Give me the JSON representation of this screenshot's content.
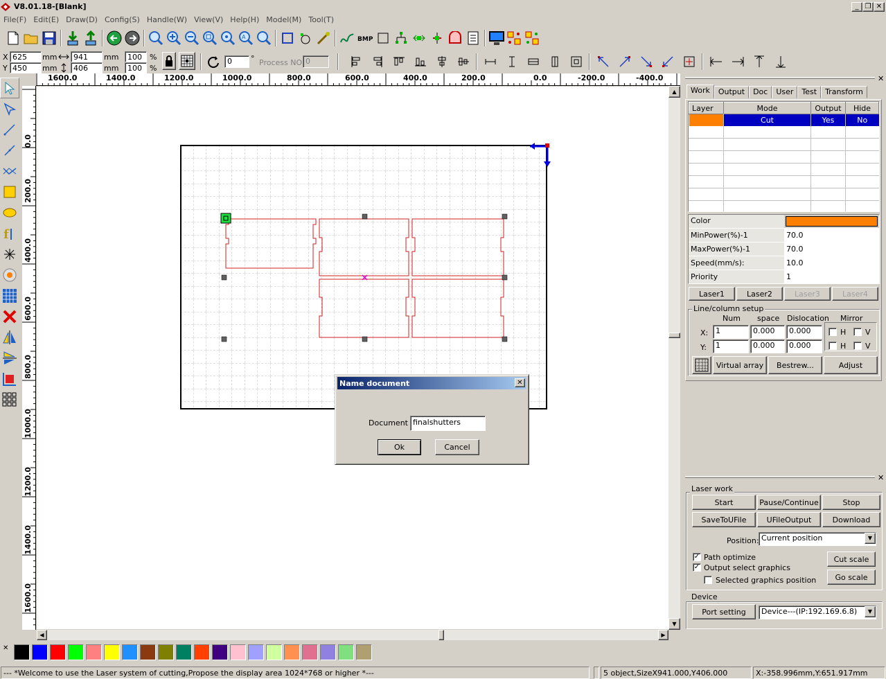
{
  "window": {
    "title": "V8.01.18-[Blank]"
  },
  "menu": [
    "File(F)",
    "Edit(E)",
    "Draw(D)",
    "Config(S)",
    "Handle(W)",
    "View(V)",
    "Help(H)",
    "Model(M)",
    "Tool(T)"
  ],
  "coords": {
    "x_label": "X",
    "x_value": "625",
    "x_unit": "mm",
    "y_label": "Y",
    "y_value": "450",
    "y_unit": "mm",
    "w_value": "941",
    "w_unit": "mm",
    "h_value": "406",
    "h_unit": "mm",
    "sx_value": "100",
    "sx_unit": "%",
    "sy_value": "100",
    "sy_unit": "%",
    "rotate_value": "0",
    "rotate_unit": "°",
    "process_label": "Process NO:",
    "process_value": "0"
  },
  "ruler_h": [
    "1600.0",
    "1400.0",
    "1200.0",
    "1000.0",
    "800.0",
    "600.0",
    "400.0",
    "200.0",
    "0.0",
    "-200.0",
    "-400.0"
  ],
  "ruler_v": [
    "0.0",
    "200.0",
    "400.0",
    "600.0",
    "800.0",
    "1000.0",
    "1200.0",
    "1400.0",
    "1600.0"
  ],
  "panel": {
    "tabs": [
      "Work",
      "Output",
      "Doc",
      "User",
      "Test",
      "Transform"
    ],
    "layer_headers": [
      "Layer",
      "Mode",
      "Output",
      "Hide"
    ],
    "layer_row": {
      "mode": "Cut",
      "output": "Yes",
      "hide": "No",
      "color": "#ff8000"
    },
    "props": [
      {
        "label": "Color",
        "value": ""
      },
      {
        "label": "MinPower(%)-1",
        "value": "70.0"
      },
      {
        "label": "MaxPower(%)-1",
        "value": "70.0"
      },
      {
        "label": "Speed(mm/s):",
        "value": "10.0"
      },
      {
        "label": "Priority",
        "value": "1"
      }
    ],
    "lasers": [
      "Laser1",
      "Laser2",
      "Laser3",
      "Laser4"
    ],
    "linecol": {
      "title": "Line/column setup",
      "h_num": "Num",
      "h_space": "space",
      "h_disl": "Dislocation",
      "h_mirror": "Mirror",
      "x_label": "X:",
      "x_num": "1",
      "x_space": "0.000",
      "x_disl": "0.000",
      "y_label": "Y:",
      "y_num": "1",
      "y_space": "0.000",
      "y_disl": "0.000",
      "h": "H",
      "v": "V"
    },
    "array_buttons": [
      "Virtual array",
      "Bestrew...",
      "Adjust"
    ]
  },
  "laserwork": {
    "title": "Laser work",
    "start": "Start",
    "pause": "Pause/Continue",
    "stop": "Stop",
    "save": "SaveToUFile",
    "ufile": "UFileOutput",
    "download": "Download",
    "position_label": "Position:",
    "position_value": "Current position",
    "path_opt": "Path optimize",
    "output_sel": "Output select graphics",
    "sel_pos": "Selected graphics position",
    "cut_scale": "Cut scale",
    "go_scale": "Go scale"
  },
  "device": {
    "title": "Device",
    "port": "Port setting",
    "device_value": "Device---(IP:192.169.6.8)"
  },
  "palette": [
    "#000000",
    "#0000ff",
    "#ff0000",
    "#00ff00",
    "#ff8080",
    "#ffff00",
    "#1e90ff",
    "#8b3a0f",
    "#808000",
    "#008060",
    "#ff4000",
    "#400080",
    "#ffc0d0",
    "#a0a0ff",
    "#d0ffa0",
    "#ff9050",
    "#e07090",
    "#9080e0",
    "#80e080",
    "#b0a070"
  ],
  "status": {
    "welcome": "--- *Welcome to use the Laser system of cutting,Propose the display area 1024*768 or higher *---",
    "objects": "5 object,SizeX941.000,Y406.000",
    "cursor": "X:-358.996mm,Y:651.917mm"
  },
  "dialog": {
    "title": "Name document",
    "label": "Document",
    "value": "finalshutters",
    "ok": "Ok",
    "cancel": "Cancel"
  }
}
